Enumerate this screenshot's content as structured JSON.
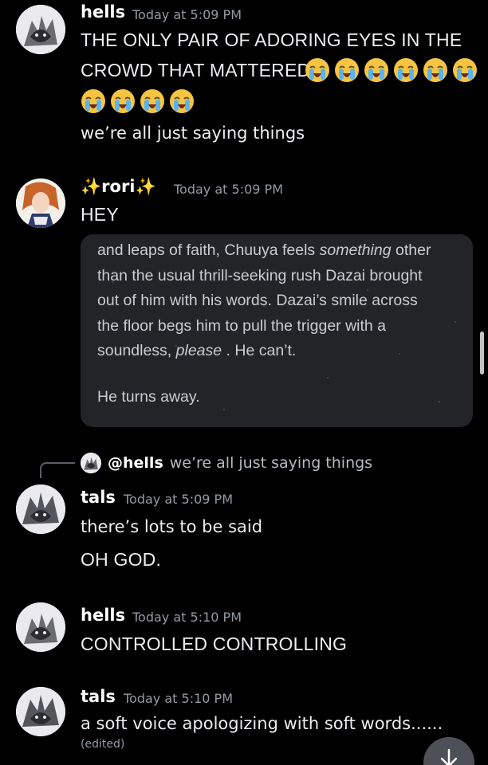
{
  "messages": [
    {
      "author": "hells",
      "timestamp": "Today at 5:09 PM",
      "lines": [
        "THE ONLY PAIR OF ADORING EYES IN THE",
        "CROWD THAT MATTERED",
        "we’re all just saying things"
      ],
      "emoji": "loudly-crying-face"
    },
    {
      "author": "rori",
      "author_sparkles": "✨",
      "timestamp": "Today at 5:09 PM",
      "lines": [
        "HEY"
      ],
      "embed": {
        "line1_pre": "and leaps of faith, Chuuya feels ",
        "line1_em": "something",
        "line1_post": " other",
        "line2": "than the usual thrill-seeking rush Dazai brought",
        "line3": "out of him with his words. Dazai’s smile across",
        "line4": "the floor begs him to pull the trigger with a",
        "line5_pre": "soundless, ",
        "line5_em": "please",
        "line5_post": " . He can’t.",
        "line6": "He turns away."
      }
    },
    {
      "reply": {
        "mention": "@hells",
        "text": "we’re all just saying things"
      },
      "author": "tals",
      "timestamp": "Today at 5:09 PM",
      "lines": [
        "there’s lots to be said",
        "OH GOD."
      ]
    },
    {
      "author": "hells",
      "timestamp": "Today at 5:10 PM",
      "lines": [
        "CONTROLLED CONTROLLING"
      ]
    },
    {
      "author": "tals",
      "timestamp": "Today at 5:10 PM",
      "lines": [
        "a soft voice apologizing with soft words......"
      ],
      "edited_label": "(edited)"
    }
  ],
  "colors": {
    "background": "#000000",
    "embed_background": "#232428",
    "timestamp": "#949ba4",
    "accent_gold": "#f5c542"
  },
  "icons": {
    "jump": "arrow-down-icon",
    "emoji": "loudly-crying-face",
    "sparkle": "sparkles"
  }
}
